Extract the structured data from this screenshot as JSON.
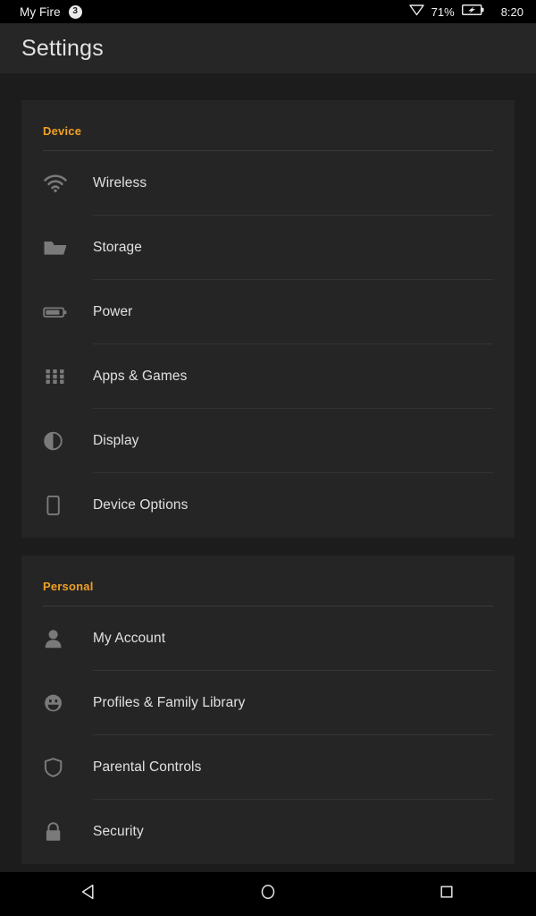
{
  "statusbar": {
    "app_label": "My Fire",
    "notification_count": "3",
    "wifi_icon": "wifi-triangle-icon",
    "battery_percent": "71%",
    "battery_icon": "battery-charging-icon",
    "clock": "8:20"
  },
  "header": {
    "title": "Settings"
  },
  "theme": {
    "accent": "#f0a023",
    "page_bg": "#1c1c1c",
    "card_bg": "#252525",
    "label_color": "#e0e0e0",
    "icon_color": "#777777"
  },
  "sections": [
    {
      "title": "Device",
      "items": [
        {
          "label": "Wireless",
          "icon": "wifi-icon"
        },
        {
          "label": "Storage",
          "icon": "folder-icon"
        },
        {
          "label": "Power",
          "icon": "battery-icon"
        },
        {
          "label": "Apps & Games",
          "icon": "app-grid-icon"
        },
        {
          "label": "Display",
          "icon": "brightness-contrast-icon"
        },
        {
          "label": "Device Options",
          "icon": "tablet-icon"
        }
      ]
    },
    {
      "title": "Personal",
      "items": [
        {
          "label": "My Account",
          "icon": "person-icon"
        },
        {
          "label": "Profiles & Family Library",
          "icon": "smiley-face-icon"
        },
        {
          "label": "Parental Controls",
          "icon": "shield-icon"
        },
        {
          "label": "Security",
          "icon": "lock-icon"
        }
      ]
    }
  ],
  "navbar": {
    "back_label": "Back",
    "home_label": "Home",
    "recents_label": "Recent apps"
  }
}
